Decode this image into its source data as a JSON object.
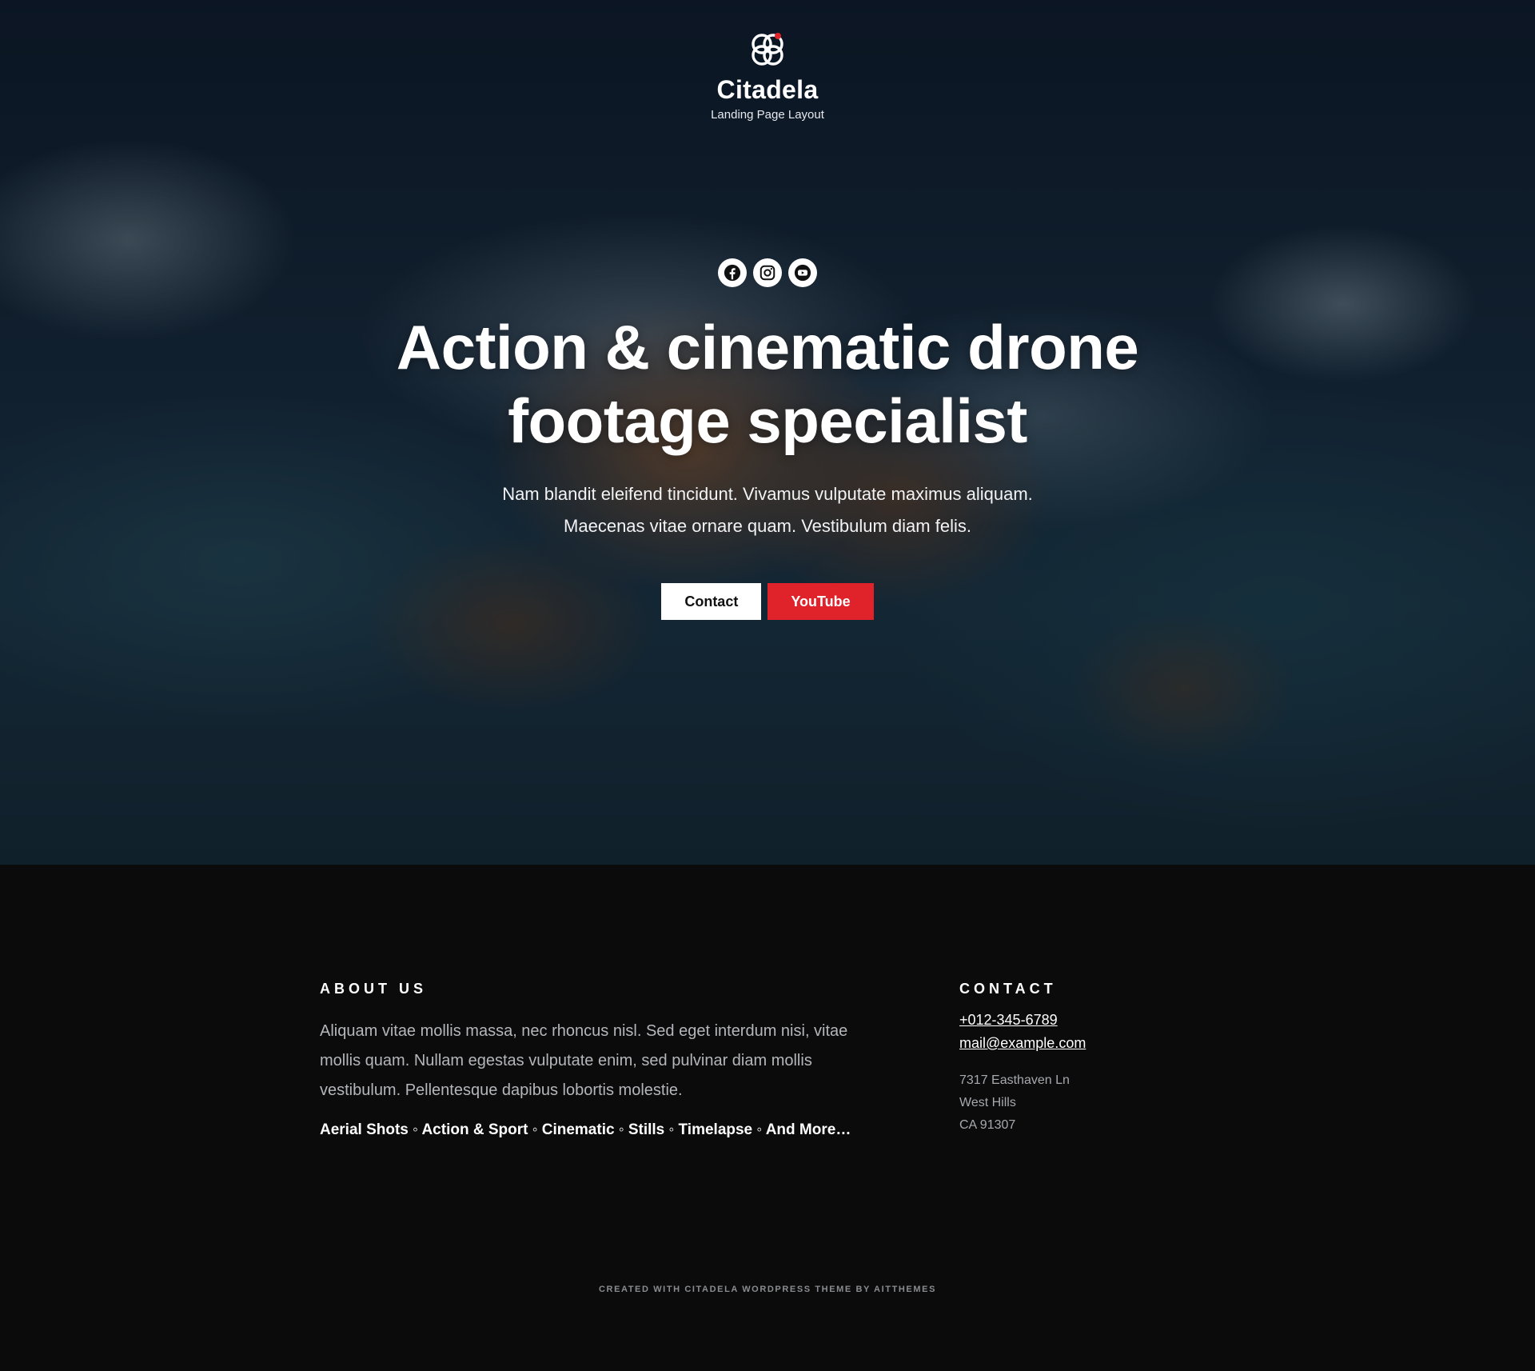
{
  "brand": {
    "name": "Citadela",
    "tagline": "Landing Page Layout",
    "logo_icon": "citadela-rings-icon",
    "accent_dot": "#e0232a"
  },
  "social": [
    {
      "name": "facebook",
      "icon": "facebook-icon"
    },
    {
      "name": "instagram",
      "icon": "instagram-icon"
    },
    {
      "name": "youtube",
      "icon": "youtube-icon"
    }
  ],
  "hero": {
    "headline_line1": "Action & cinematic drone",
    "headline_line2": "footage specialist",
    "lead_line1": "Nam blandit eleifend tincidunt. Vivamus vulputate maximus aliquam.",
    "lead_line2": "Maecenas vitae ornare quam. Vestibulum diam felis.",
    "contact_label": "Contact",
    "youtube_label": "YouTube"
  },
  "about": {
    "title": "ABOUT US",
    "text": "Aliquam vitae mollis massa, nec rhoncus nisl. Sed eget interdum nisi, vitae mollis quam. Nullam egestas vulputate enim, sed pulvinar diam mollis vestibulum. Pellentesque dapibus lobortis molestie.",
    "tags": "Aerial Shots ◦ Action & Sport ◦ Cinematic ◦ Stills ◦ Timelapse ◦ And More…"
  },
  "contact": {
    "title": "CONTACT",
    "phone": "+012-345-6789",
    "email": "mail@example.com",
    "address_line1": "7317 Easthaven Ln",
    "address_line2": "West Hills",
    "address_line3": "CA 91307"
  },
  "footer": {
    "credit": "CREATED WITH CITADELA WORDPRESS THEME BY AITTHEMES"
  },
  "colors": {
    "youtube_red": "#e0232a",
    "footer_bg": "#0b0b0c"
  }
}
